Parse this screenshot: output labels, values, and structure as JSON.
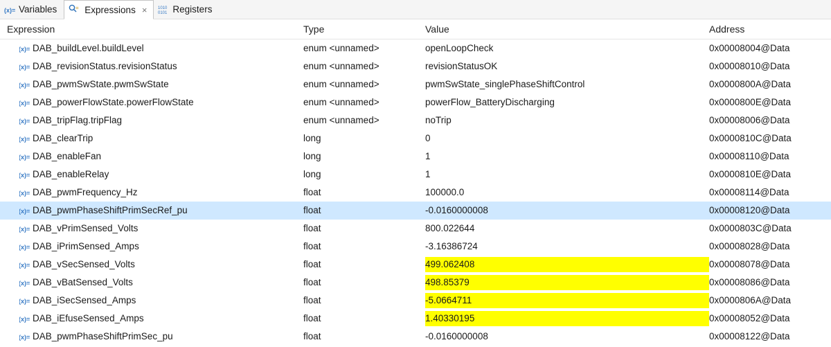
{
  "tabs": {
    "variables": "Variables",
    "expressions": "Expressions",
    "registers": "Registers"
  },
  "columns": {
    "expression": "Expression",
    "type": "Type",
    "value": "Value",
    "address": "Address"
  },
  "rows": [
    {
      "expr": "DAB_buildLevel.buildLevel",
      "type": "enum <unnamed>",
      "value": "openLoopCheck",
      "addr": "0x00008004@Data",
      "selected": false,
      "highlight": false
    },
    {
      "expr": "DAB_revisionStatus.revisionStatus",
      "type": "enum <unnamed>",
      "value": "revisionStatusOK",
      "addr": "0x00008010@Data",
      "selected": false,
      "highlight": false
    },
    {
      "expr": "DAB_pwmSwState.pwmSwState",
      "type": "enum <unnamed>",
      "value": "pwmSwState_singlePhaseShiftControl",
      "addr": "0x0000800A@Data",
      "selected": false,
      "highlight": false
    },
    {
      "expr": "DAB_powerFlowState.powerFlowState",
      "type": "enum <unnamed>",
      "value": "powerFlow_BatteryDischarging",
      "addr": "0x0000800E@Data",
      "selected": false,
      "highlight": false
    },
    {
      "expr": "DAB_tripFlag.tripFlag",
      "type": "enum <unnamed>",
      "value": "noTrip",
      "addr": "0x00008006@Data",
      "selected": false,
      "highlight": false
    },
    {
      "expr": "DAB_clearTrip",
      "type": "long",
      "value": "0",
      "addr": "0x0000810C@Data",
      "selected": false,
      "highlight": false
    },
    {
      "expr": "DAB_enableFan",
      "type": "long",
      "value": "1",
      "addr": "0x00008110@Data",
      "selected": false,
      "highlight": false
    },
    {
      "expr": "DAB_enableRelay",
      "type": "long",
      "value": "1",
      "addr": "0x0000810E@Data",
      "selected": false,
      "highlight": false
    },
    {
      "expr": "DAB_pwmFrequency_Hz",
      "type": "float",
      "value": "100000.0",
      "addr": "0x00008114@Data",
      "selected": false,
      "highlight": false
    },
    {
      "expr": "DAB_pwmPhaseShiftPrimSecRef_pu",
      "type": "float",
      "value": "-0.0160000008",
      "addr": "0x00008120@Data",
      "selected": true,
      "highlight": false
    },
    {
      "expr": "DAB_vPrimSensed_Volts",
      "type": "float",
      "value": "800.022644",
      "addr": "0x0000803C@Data",
      "selected": false,
      "highlight": false
    },
    {
      "expr": "DAB_iPrimSensed_Amps",
      "type": "float",
      "value": "-3.16386724",
      "addr": "0x00008028@Data",
      "selected": false,
      "highlight": false
    },
    {
      "expr": "DAB_vSecSensed_Volts",
      "type": "float",
      "value": "499.062408",
      "addr": "0x00008078@Data",
      "selected": false,
      "highlight": true
    },
    {
      "expr": "DAB_vBatSensed_Volts",
      "type": "float",
      "value": "498.85379",
      "addr": "0x00008086@Data",
      "selected": false,
      "highlight": true
    },
    {
      "expr": "DAB_iSecSensed_Amps",
      "type": "float",
      "value": "-5.0664711",
      "addr": "0x0000806A@Data",
      "selected": false,
      "highlight": true
    },
    {
      "expr": "DAB_iEfuseSensed_Amps",
      "type": "float",
      "value": "1.40330195",
      "addr": "0x00008052@Data",
      "selected": false,
      "highlight": true
    },
    {
      "expr": "DAB_pwmPhaseShiftPrimSec_pu",
      "type": "float",
      "value": "-0.0160000008",
      "addr": "0x00008122@Data",
      "selected": false,
      "highlight": false
    }
  ]
}
